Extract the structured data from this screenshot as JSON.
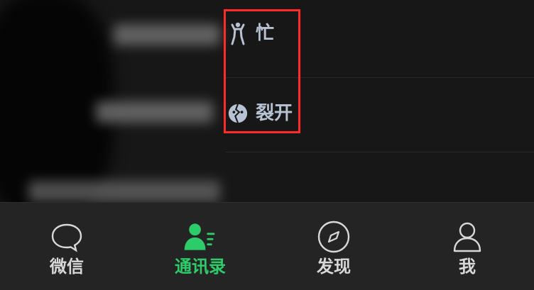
{
  "contacts": {
    "rows": [
      {
        "status_label": "忙"
      },
      {
        "status_label": "裂开"
      },
      {
        "status_label": ""
      }
    ]
  },
  "status_icons": [
    "busy-person-icon",
    "cracked-face-icon"
  ],
  "tabbar": {
    "items": [
      {
        "label": "微信",
        "icon": "chat-icon",
        "active": false
      },
      {
        "label": "通讯录",
        "icon": "contacts-icon",
        "active": true
      },
      {
        "label": "发现",
        "icon": "compass-icon",
        "active": false
      },
      {
        "label": "我",
        "icon": "person-icon",
        "active": false
      }
    ]
  },
  "colors": {
    "background": "#171717",
    "tabbar_background": "#242424",
    "status_text": "#b7c2d2",
    "active_tab": "#2dcc6a",
    "inactive_tab": "#d8d8d8",
    "highlight_box": "#ff2a2a"
  }
}
